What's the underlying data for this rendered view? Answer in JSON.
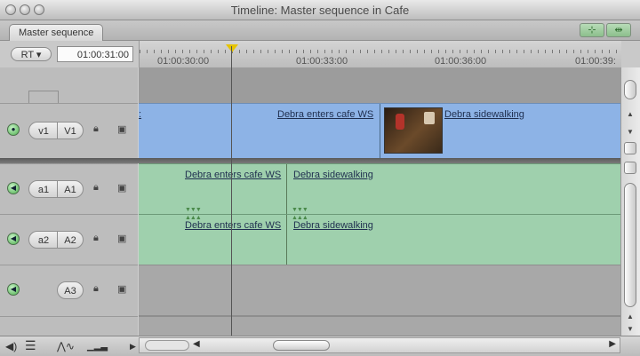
{
  "window": {
    "title": "Timeline: Master sequence in Cafe"
  },
  "tabs": [
    {
      "label": "Master sequence"
    }
  ],
  "controls": {
    "rt_label": "RT ▾",
    "timecode": "01:00:31:00"
  },
  "ruler": {
    "labels": [
      "01:00:30:00",
      "01:00:33:00",
      "01:00:36:00",
      "01:00:39:"
    ]
  },
  "tracks": {
    "v1": {
      "source": "v1",
      "dest": "V1"
    },
    "a1": {
      "source": "a1",
      "dest": "A1"
    },
    "a2": {
      "source": "a2",
      "dest": "A2"
    },
    "a3": {
      "dest": "A3"
    }
  },
  "clips": {
    "v1_clip1": "Debra enters cafe WS",
    "v1_clip2": "Debra sidewalking",
    "a1_clip1": "Debra enters cafe WS",
    "a1_clip2": "Debra sidewalking",
    "a2_clip1": "Debra enters cafe WS",
    "a2_clip2": "Debra sidewalking"
  },
  "icons": {
    "track_on": "green-dot-icon",
    "lock": "lock-icon",
    "sync": "auto-select-icon",
    "playhead": "yellow-triangle-icon"
  },
  "colors": {
    "video_track": "#8db3e6",
    "audio_track": "#9fd0ad",
    "playhead": "#e6c400"
  }
}
